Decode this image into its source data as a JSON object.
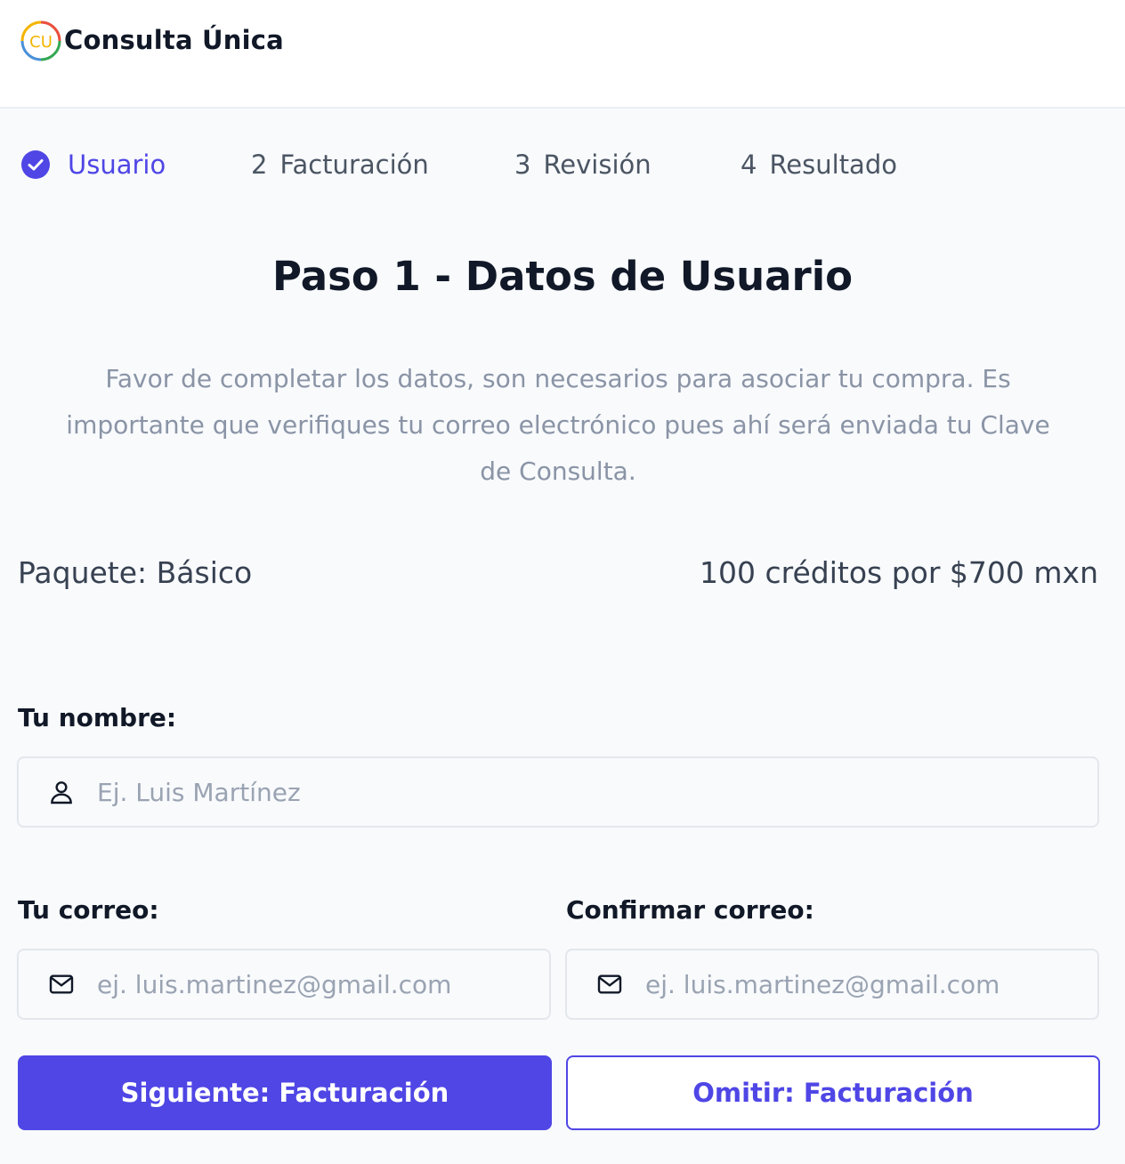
{
  "app": {
    "brand": "Consulta Única",
    "logo_text": "CU"
  },
  "colors": {
    "accent": "#4f46e5",
    "muted": "#8a94a6"
  },
  "steps": [
    {
      "label": "Usuario",
      "status": "complete",
      "icon": "check-circle-icon"
    },
    {
      "number": "2",
      "label": "Facturación"
    },
    {
      "number": "3",
      "label": "Revisión"
    },
    {
      "number": "4",
      "label": "Resultado"
    }
  ],
  "page": {
    "title": "Paso 1 - Datos de Usuario",
    "description": "Favor de completar los datos, son necesarios para asociar tu compra. Es importante que verifiques tu correo electrónico pues ahí será enviada tu Clave de Consulta."
  },
  "package": {
    "name": "Paquete: Básico",
    "price": "100 créditos por $700 mxn"
  },
  "form": {
    "name": {
      "label": "Tu nombre:",
      "placeholder": "Ej. Luis Martínez",
      "value": "",
      "icon": "user-icon"
    },
    "email": {
      "label": "Tu correo:",
      "placeholder": "ej. luis.martinez@gmail.com",
      "value": "",
      "icon": "mail-icon"
    },
    "confirm_email": {
      "label": "Confirmar correo:",
      "placeholder": "ej. luis.martinez@gmail.com",
      "value": "",
      "icon": "mail-icon"
    }
  },
  "actions": {
    "next_label": "Siguiente: Facturación",
    "skip_label": "Omitir: Facturación"
  }
}
